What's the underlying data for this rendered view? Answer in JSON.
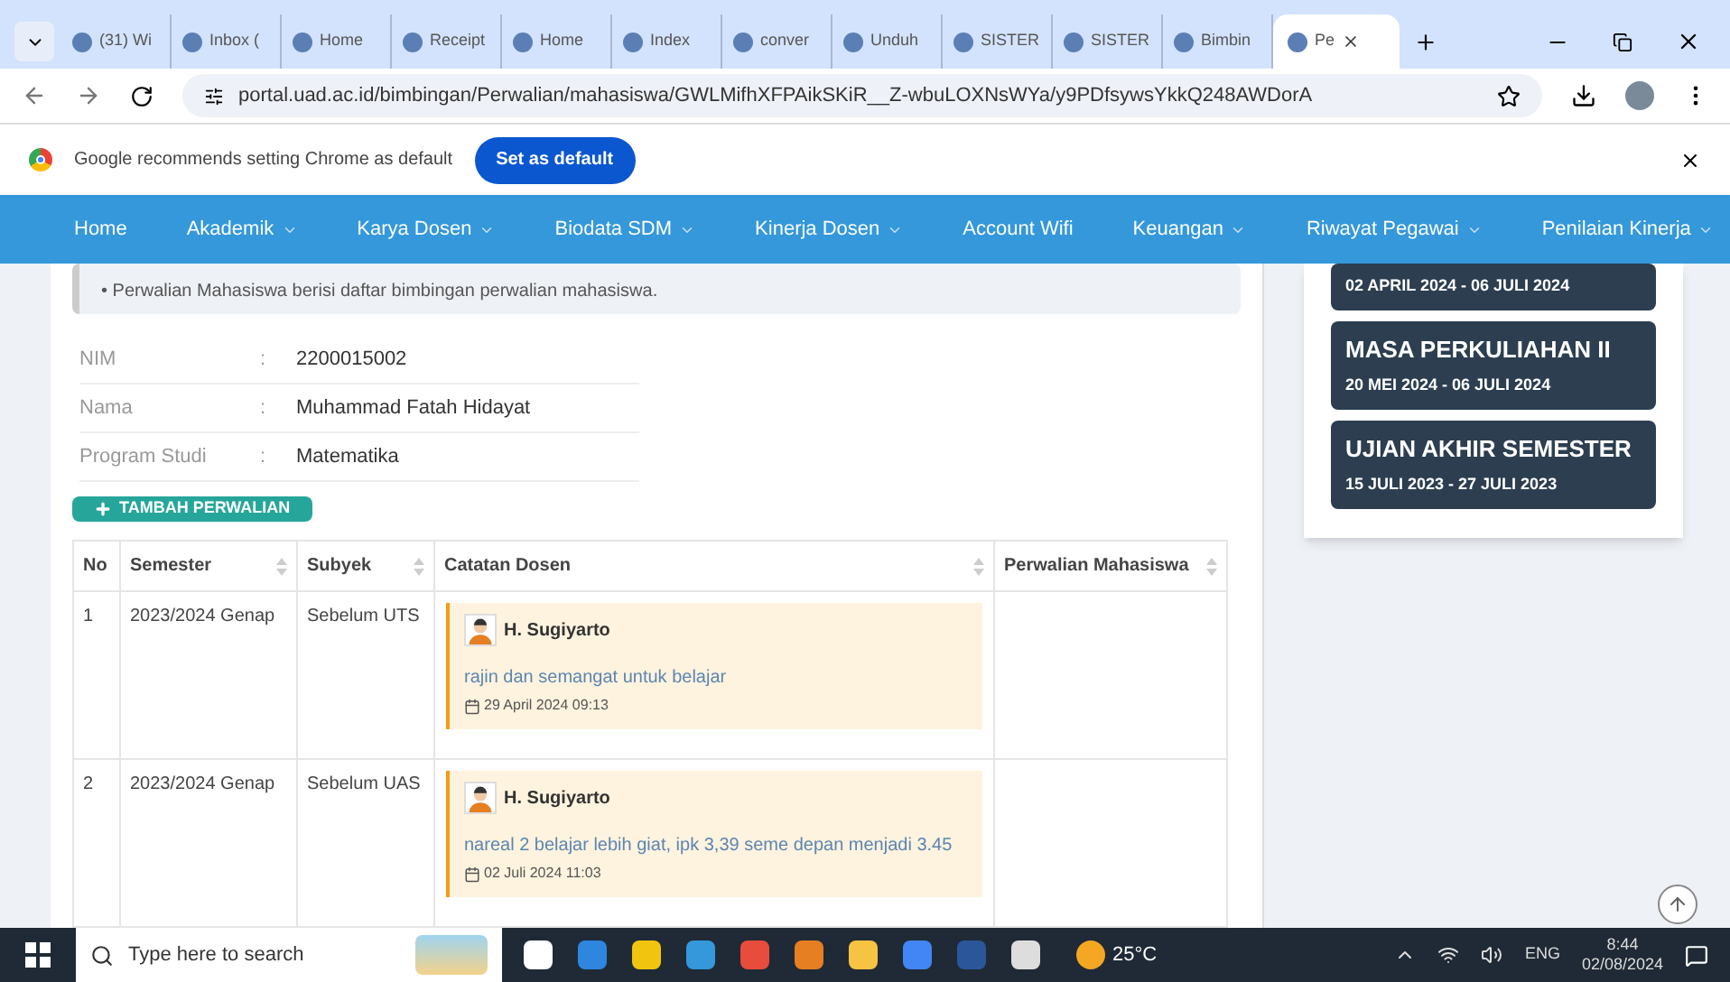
{
  "browser": {
    "tabs": [
      {
        "title": "(31) Wi",
        "selected": false
      },
      {
        "title": "Inbox (",
        "selected": false
      },
      {
        "title": "Home",
        "selected": false
      },
      {
        "title": "Receipt",
        "selected": false
      },
      {
        "title": "Home",
        "selected": false
      },
      {
        "title": "Index",
        "selected": false
      },
      {
        "title": "conver",
        "selected": false
      },
      {
        "title": "Unduh",
        "selected": false
      },
      {
        "title": "SISTER",
        "selected": false
      },
      {
        "title": "SISTER",
        "selected": false
      },
      {
        "title": "Bimbin",
        "selected": false
      },
      {
        "title": "Pe",
        "selected": true
      }
    ],
    "url": "portal.uad.ac.id/bimbingan/Perwalian/mahasiswa/GWLMifhXFPAikSKiR__Z-wbuLOXNsWYa/y9PDfsywsYkkQ248AWDorA",
    "infobar": {
      "message": "Google recommends setting Chrome as default",
      "button": "Set as default"
    }
  },
  "nav": [
    {
      "label": "Home",
      "dropdown": false
    },
    {
      "label": "Akademik",
      "dropdown": true
    },
    {
      "label": "Karya Dosen",
      "dropdown": true
    },
    {
      "label": "Biodata SDM",
      "dropdown": true
    },
    {
      "label": "Kinerja Dosen",
      "dropdown": true
    },
    {
      "label": "Account Wifi",
      "dropdown": false
    },
    {
      "label": "Keuangan",
      "dropdown": true
    },
    {
      "label": "Riwayat Pegawai",
      "dropdown": true
    },
    {
      "label": "Penilaian Kinerja",
      "dropdown": true
    }
  ],
  "notice": "• Perwalian Mahasiswa berisi daftar bimbingan perwalian mahasiswa.",
  "student": [
    {
      "label": "NIM",
      "separator": ":",
      "value": "2200015002"
    },
    {
      "label": "Nama",
      "separator": ":",
      "value": "Muhammad Fatah Hidayat"
    },
    {
      "label": "Program Studi",
      "separator": ":",
      "value": "Matematika"
    }
  ],
  "add_button": "TAMBAH PERWALIAN",
  "table": {
    "columns": [
      {
        "label": "No",
        "sortable": false
      },
      {
        "label": "Semester",
        "sortable": true
      },
      {
        "label": "Subyek",
        "sortable": true
      },
      {
        "label": "Catatan Dosen",
        "sortable": true
      },
      {
        "label": "Perwalian Mahasiswa",
        "sortable": true
      }
    ],
    "rows": [
      {
        "no": "1",
        "semester": "2023/2024 Genap",
        "subyek": "Sebelum UTS",
        "note": {
          "author": "H. Sugiyarto",
          "text": "rajin dan semangat untuk belajar",
          "date": "29 April 2024 09:13"
        }
      },
      {
        "no": "2",
        "semester": "2023/2024 Genap",
        "subyek": "Sebelum UAS",
        "note": {
          "author": "H. Sugiyarto",
          "text": "nareal 2 belajar lebih giat, ipk 3,39 seme depan menjadi 3.45",
          "date": "02 Juli 2024 11:03"
        }
      }
    ]
  },
  "schedule": [
    {
      "dates": "02 APRIL 2024 - 06 JULI 2024"
    },
    {
      "title": "MASA PERKULIAHAN II",
      "dates": "20 MEI 2024 - 06 JULI 2024"
    },
    {
      "title": "UJIAN AKHIR SEMESTER",
      "dates": "15 JULI 2023 - 27 JULI 2023"
    }
  ],
  "taskbar": {
    "search_placeholder": "Type here to search",
    "weather": "25°C",
    "language": "ENG",
    "time": "8:44",
    "date": "02/08/2024"
  }
}
